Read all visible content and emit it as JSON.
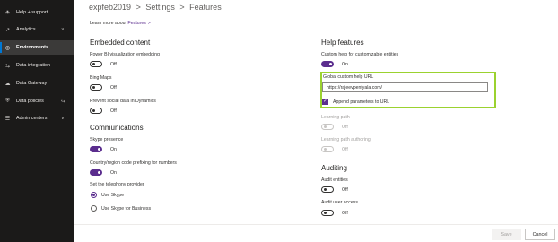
{
  "sidebar": {
    "items": [
      {
        "label": "Help + support",
        "icon": "help-support-icon",
        "glyph": "☘",
        "chevron": false
      },
      {
        "label": "Analytics",
        "icon": "analytics-icon",
        "glyph": "↗",
        "chevron": true
      },
      {
        "label": "Environments",
        "icon": "environments-icon",
        "glyph": "◎",
        "chevron": false,
        "active": true
      },
      {
        "label": "Data integration",
        "icon": "data-integration-icon",
        "glyph": "⇆",
        "chevron": false
      },
      {
        "label": "Data Gateway",
        "icon": "data-gateway-icon",
        "glyph": "☁",
        "chevron": false
      },
      {
        "label": "Data policies",
        "icon": "data-policies-icon",
        "glyph": "⛨",
        "chevron": false,
        "external": true
      },
      {
        "label": "Admin centers",
        "icon": "admin-centers-icon",
        "glyph": "☰",
        "chevron": true
      }
    ],
    "chevron_glyph": "∨",
    "external_glyph": "↪"
  },
  "breadcrumb": {
    "environment": "expfeb2019",
    "sep1": ">",
    "settings": "Settings",
    "sep2": ">",
    "current": "Features"
  },
  "learn_more": {
    "prefix": "Learn more about ",
    "link": "Features",
    "icon": "external-link-icon",
    "glyph": "↗"
  },
  "embedded": {
    "heading": "Embedded content",
    "powerbi": {
      "label": "Power BI visualization embedding",
      "state": "Off",
      "on": false
    },
    "bing": {
      "label": "Bing Maps",
      "state": "Off",
      "on": false
    },
    "social": {
      "label": "Prevent social data in Dynamics",
      "state": "Off",
      "on": false
    }
  },
  "communications": {
    "heading": "Communications",
    "skype": {
      "label": "Skype presence",
      "state": "On",
      "on": true
    },
    "country": {
      "label": "Country/region code prefixing for numbers",
      "state": "On",
      "on": true
    },
    "telephony": {
      "label": "Set the telephony provider",
      "options": [
        {
          "label": "Use Skype",
          "selected": true
        },
        {
          "label": "Use Skype for Business",
          "selected": false
        }
      ]
    }
  },
  "help_features": {
    "heading": "Help features",
    "custom_help": {
      "label": "Custom help for customizable entities",
      "state": "On",
      "on": true
    },
    "url": {
      "label": "Global custom help URL",
      "value": "https://rajeevpentyala.com/"
    },
    "append": {
      "label": "Append parameters to URL",
      "checked": true
    },
    "learning_path": {
      "label": "Learning path",
      "state": "Off",
      "disabled": true
    },
    "learning_path_authoring": {
      "label": "Learning path authoring",
      "state": "Off",
      "disabled": true
    }
  },
  "auditing": {
    "heading": "Auditing",
    "entities": {
      "label": "Audit entities",
      "state": "Off",
      "on": false
    },
    "user_access": {
      "label": "Audit user access",
      "state": "Off",
      "on": false
    }
  },
  "footer": {
    "save_label": "Save",
    "cancel_label": "Cancel"
  },
  "colors": {
    "accent": "#5b2d8e",
    "highlight": "#9bd22f",
    "sidebar_bg": "#1b1a19"
  }
}
